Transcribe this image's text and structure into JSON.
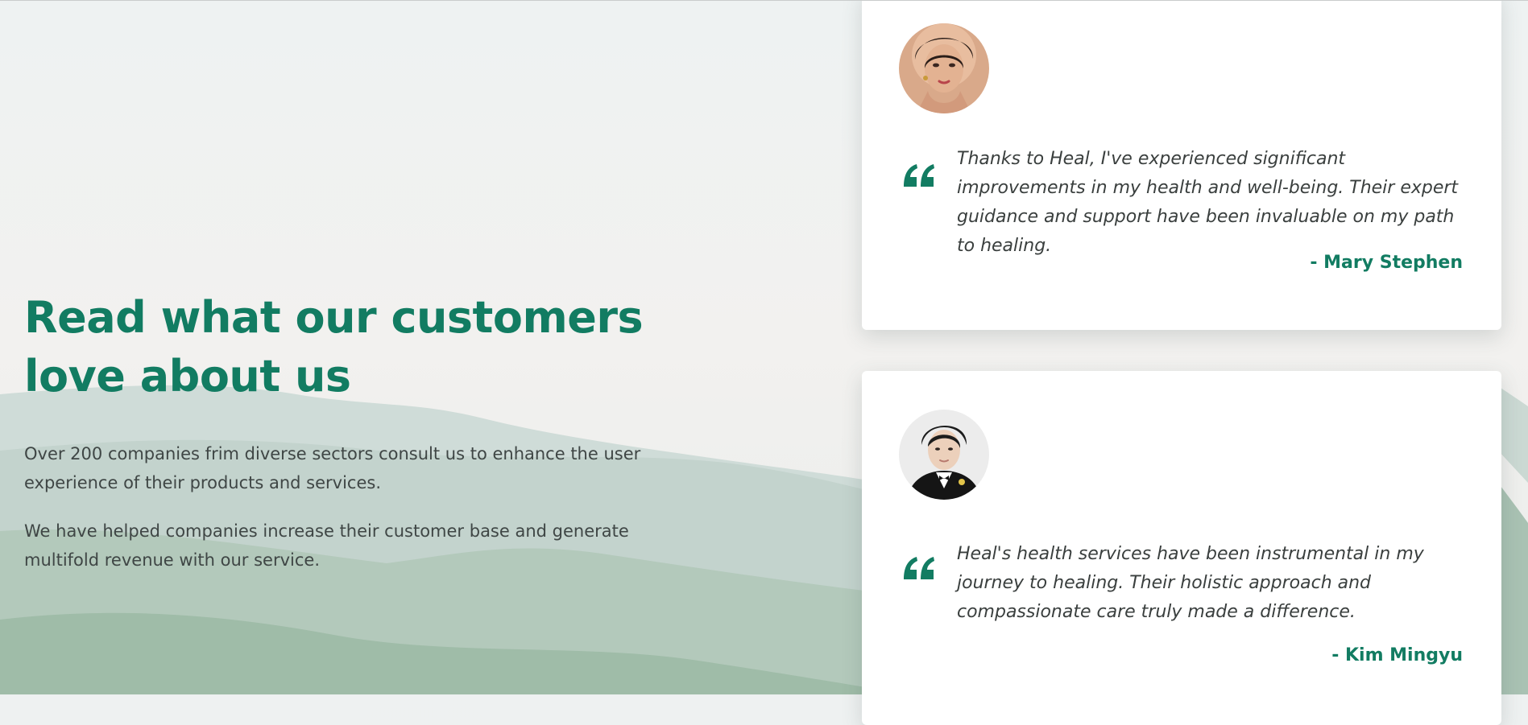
{
  "section": {
    "heading": "Read what our customers\nlove about us",
    "paragraphs": [
      "Over 200 companies frim diverse sectors consult us to enhance the user experience of their products and services.",
      "We have helped companies increase their customer base and generate multifold revenue with our service."
    ]
  },
  "testimonials": [
    {
      "quote": "Thanks to Heal, I've experienced significant improvements in my health and well-being. Their expert guidance and support have been invaluable on my path to healing.",
      "author": "- Mary Stephen",
      "avatar_icon": "woman-portrait-avatar",
      "quote_icon": "quote-mark-icon"
    },
    {
      "quote": "Heal's health services have been instrumental in my journey to healing. Their holistic approach and compassionate care truly made a difference.",
      "author": "- Kim Mingyu",
      "avatar_icon": "man-portrait-avatar",
      "quote_icon": "quote-mark-icon"
    }
  ],
  "colors": {
    "accent": "#127c62",
    "body_text": "#3f4645",
    "card_background": "#ffffff"
  }
}
